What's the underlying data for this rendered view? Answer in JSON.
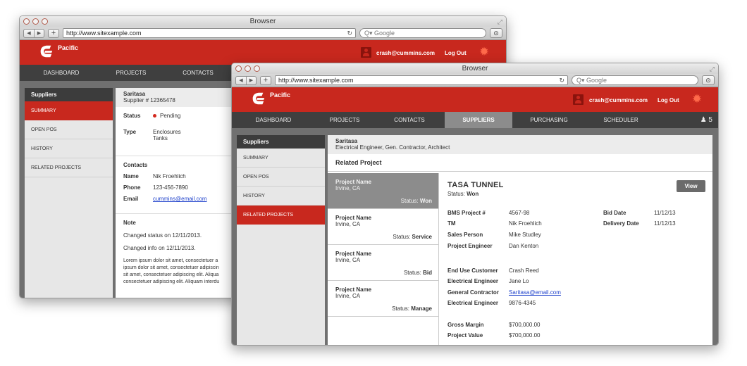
{
  "browser": {
    "title": "Browser",
    "url": "http://www.sitexample.com",
    "search_placeholder": "Q▾ Google"
  },
  "app": {
    "logo_text": "Pacific",
    "user_email": "crash@cummins.com",
    "logout": "Log Out",
    "brand_color": "#c8281e"
  },
  "window1": {
    "nav": [
      "DASHBOARD",
      "PROJECTS",
      "CONTACTS"
    ],
    "sidebar": {
      "heading": "Suppliers",
      "items": [
        "SUMMARY",
        "OPEN POS",
        "HISTORY",
        "RELATED PROJECTS"
      ],
      "active_index": 0
    },
    "supplier": {
      "name": "Saritasa",
      "sub": "Supplier # 12365478"
    },
    "status": {
      "label": "Status",
      "value": "Pending"
    },
    "type": {
      "label": "Type",
      "values": [
        "Enclosures",
        "Tanks"
      ]
    },
    "contacts": {
      "heading": "Contacts",
      "name_label": "Name",
      "name": "Nik Froehlich",
      "phone_label": "Phone",
      "phone": "123-456-7890",
      "email_label": "Email",
      "email": "cummins@email.com"
    },
    "note": {
      "heading": "Note",
      "line1": "Changed status on 12/11/2013.",
      "line2": "Changed  info on 12/11/2013.",
      "lorem": [
        "Lorem ipsum dolor sit amet, consectetuer a",
        "ipsum dolor sit amet, consectetuer adipiscin",
        "sit amet, consectetuer adipiscing elit. Aliqua",
        "consectetuer adipiscing elit. Aliquam interdu"
      ]
    }
  },
  "window2": {
    "nav": [
      "DASHBOARD",
      "PROJECTS",
      "CONTACTS",
      "SUPPLIERS",
      "PURCHASING",
      "SCHEDULER"
    ],
    "nav_active_index": 3,
    "nav_count": "♟ 5",
    "sidebar": {
      "heading": "Suppliers",
      "items": [
        "SUMMARY",
        "OPEN POS",
        "HISTORY",
        "RELATED PROJECTS"
      ],
      "active_index": 3
    },
    "supplier": {
      "name": "Saritasa",
      "sub": "Electrical Engineer, Gen. Contractor,  Architect"
    },
    "related_heading": "Related Project",
    "projects": [
      {
        "name": "Project Name",
        "location": "Irvine, CA",
        "status_label": "Status:",
        "status": "Won"
      },
      {
        "name": "Project Name",
        "location": "Irvine, CA",
        "status_label": "Status:",
        "status": "Service"
      },
      {
        "name": "Project Name",
        "location": "Irvine, CA",
        "status_label": "Status:",
        "status": "Bid"
      },
      {
        "name": "Project Name",
        "location": "Irvine, CA",
        "status_label": "Status:",
        "status": "Manage"
      }
    ],
    "detail": {
      "title": "TASA TUNNEL",
      "status_label": "Status:",
      "status": "Won",
      "view_button": "View",
      "fields": [
        {
          "label": "BMS Project #",
          "value": "4567-98"
        },
        {
          "label": "TM",
          "value": "Nik Froehlich"
        },
        {
          "label": "Sales Person",
          "value": "Mike Studley"
        },
        {
          "label": "Project Engineer",
          "value": "Dan Kenton"
        },
        {
          "label": "End Use Customer",
          "value": "Crash Reed"
        },
        {
          "label": "Electrical Engineer",
          "value": "Jane Lo"
        },
        {
          "label": "General Contractor",
          "value": "Saritasa@email.com"
        },
        {
          "label": "Electrical Engineer",
          "value": "9876-4345"
        },
        {
          "label": "Gross Margin",
          "value": "$700,000.00"
        },
        {
          "label": "Project Value",
          "value": "$700,000.00"
        }
      ],
      "dates": [
        {
          "label": "Bid Date",
          "value": "11/12/13"
        },
        {
          "label": "Delivery Date",
          "value": "11/12/13"
        }
      ]
    }
  }
}
